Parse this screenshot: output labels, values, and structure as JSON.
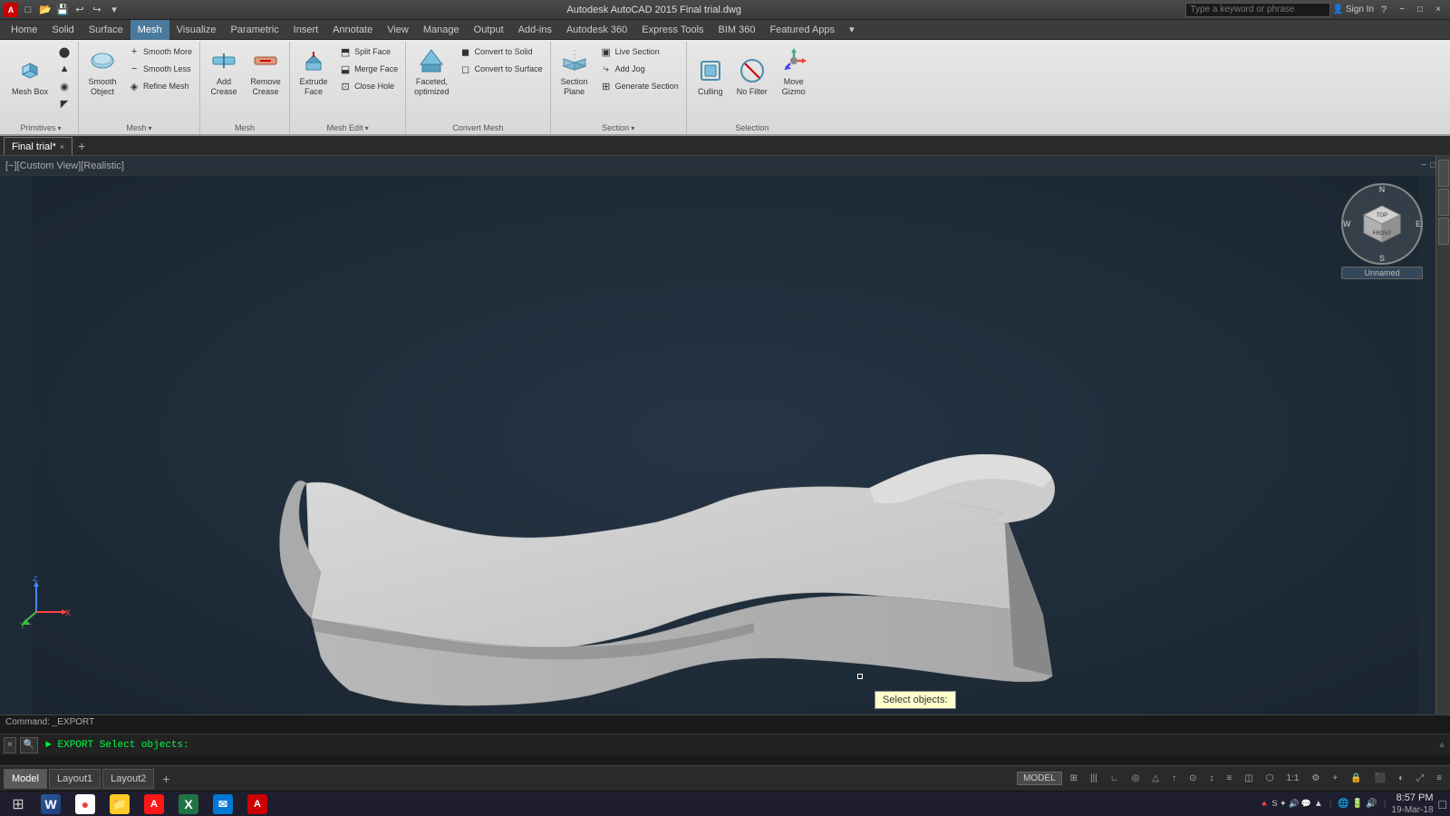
{
  "titlebar": {
    "title": "Autodesk AutoCAD 2015  Final trial.dwg",
    "search_placeholder": "Type a keyword or phrase",
    "sign_in": "Sign In",
    "app_icon": "A",
    "minimize": "−",
    "maximize": "□",
    "close": "×",
    "restore_down": "❐"
  },
  "menubar": {
    "items": [
      "Home",
      "Solid",
      "Surface",
      "Mesh",
      "Visualize",
      "Parametric",
      "Insert",
      "Annotate",
      "View",
      "Manage",
      "Output",
      "Add-ins",
      "Autodesk 360",
      "Express Tools",
      "BIM 360",
      "Featured Apps"
    ]
  },
  "ribbon": {
    "active_tab": "Mesh",
    "groups": [
      {
        "label": "Primitives",
        "has_arrow": true,
        "buttons_large": [
          {
            "id": "mesh-box",
            "label": "Mesh Box",
            "icon": "⬛"
          }
        ],
        "buttons_small_col1": [
          {
            "id": "mesh-cylinder",
            "label": "",
            "icon": "⬤"
          },
          {
            "id": "mesh-cone",
            "label": "",
            "icon": "▲"
          }
        ],
        "buttons_small_col2": [
          {
            "id": "mesh-sphere",
            "label": "",
            "icon": "◉"
          },
          {
            "id": "mesh-wedge",
            "label": "",
            "icon": "◤"
          }
        ]
      },
      {
        "label": "Mesh",
        "has_arrow": true,
        "buttons_large": [
          {
            "id": "smooth-object",
            "label": "Smooth Object",
            "icon": "✦"
          }
        ],
        "buttons_small": [
          {
            "id": "smooth-more",
            "label": "Smooth More",
            "icon": "+"
          },
          {
            "id": "smooth-less",
            "label": "Smooth Less",
            "icon": "−"
          },
          {
            "id": "refine-mesh",
            "label": "Refine Mesh",
            "icon": "◈"
          }
        ]
      },
      {
        "label": "Mesh",
        "has_arrow": false,
        "buttons_large": [
          {
            "id": "add-crease",
            "label": "Add Crease",
            "icon": "⟊"
          },
          {
            "id": "remove-crease",
            "label": "Remove Crease",
            "icon": "⟋"
          }
        ]
      },
      {
        "label": "Mesh Edit",
        "has_arrow": true,
        "buttons_large": [
          {
            "id": "extrude-face",
            "label": "Extrude Face",
            "icon": "⬆"
          }
        ],
        "buttons_small": [
          {
            "id": "split-face",
            "label": "Split Face",
            "icon": "⬒"
          },
          {
            "id": "merge-face",
            "label": "Merge Face",
            "icon": "⬓"
          },
          {
            "id": "close-hole",
            "label": "Close Hole",
            "icon": "⬔"
          }
        ]
      },
      {
        "label": "Convert Mesh",
        "has_arrow": false,
        "buttons_large": [
          {
            "id": "faceted-optimized",
            "label": "Faceted, optimized",
            "icon": "⬡"
          }
        ],
        "buttons_small": [
          {
            "id": "convert-to-solid",
            "label": "Convert to Solid",
            "icon": "◼"
          },
          {
            "id": "convert-to-surface",
            "label": "Convert to Surface",
            "icon": "◻"
          }
        ]
      },
      {
        "label": "Section",
        "has_arrow": true,
        "buttons_large": [
          {
            "id": "section-plane",
            "label": "Section Plane",
            "icon": "⧉"
          }
        ],
        "buttons_small": [
          {
            "id": "live-section",
            "label": "Live Section",
            "icon": "⬛"
          },
          {
            "id": "add-jog",
            "label": "Add Jog",
            "icon": "⤷"
          },
          {
            "id": "generate-section",
            "label": "Generate Section",
            "icon": "⊞"
          }
        ]
      },
      {
        "label": "Selection",
        "has_arrow": false,
        "buttons_large": [
          {
            "id": "culling",
            "label": "Culling",
            "icon": "⊡"
          },
          {
            "id": "no-filter",
            "label": "No Filter",
            "icon": "⊘"
          },
          {
            "id": "move-gizmo",
            "label": "Move Gizmo",
            "icon": "⊕"
          }
        ]
      }
    ]
  },
  "viewport": {
    "label": "[−][Custom View][Realistic]",
    "view_close": "×",
    "view_max": "□",
    "view_restore": "−"
  },
  "viewcube": {
    "top": "TOP",
    "front": "FRONT",
    "north": "N",
    "south": "S",
    "east": "E",
    "west": "W",
    "unnamed": "Unnamed"
  },
  "tooltip": {
    "text": "Select objects:"
  },
  "command": {
    "label": "Command:  _EXPORT",
    "input_text": "► EXPORT Select objects:",
    "icon_x": "×",
    "icon_search": "🔍"
  },
  "status_bar": {
    "model_btn": "MODEL",
    "right_icons": [
      "⊞",
      "|||",
      "∷",
      "≡",
      "↕",
      "⊿",
      "↑",
      "⊙",
      "1:1",
      "⚙",
      "＋",
      "✱",
      "◫",
      "⬜",
      "⊡",
      "⬡"
    ]
  },
  "doc_tabs": {
    "tabs": [
      {
        "label": "Final trial*",
        "active": true
      },
      {
        "label": "+",
        "is_add": true
      }
    ]
  },
  "layout_tabs": {
    "tabs": [
      {
        "label": "Model",
        "active": true
      },
      {
        "label": "Layout1",
        "active": false
      },
      {
        "label": "Layout2",
        "active": false
      }
    ],
    "add": "+"
  },
  "taskbar": {
    "apps": [
      {
        "id": "windows",
        "icon": "⊞",
        "label": "Windows"
      },
      {
        "id": "word",
        "icon": "W",
        "label": "Word",
        "color": "app-word"
      },
      {
        "id": "chrome",
        "icon": "●",
        "label": "Chrome",
        "color": "app-chrome"
      },
      {
        "id": "files",
        "icon": "📁",
        "label": "Files",
        "color": "app-files"
      },
      {
        "id": "acrobat",
        "icon": "A",
        "label": "Acrobat",
        "color": "app-acrobat"
      },
      {
        "id": "excel",
        "icon": "X",
        "label": "Excel",
        "color": "app-excel"
      },
      {
        "id": "mail",
        "icon": "✉",
        "label": "Mail",
        "color": "app-mail"
      },
      {
        "id": "autocad",
        "icon": "A",
        "label": "AutoCAD",
        "color": "app-autocad"
      }
    ],
    "clock": {
      "time": "8:57 PM",
      "date": "19-Mar-18"
    },
    "sys_icons": [
      "🔊",
      "💬",
      "🌐",
      "✦",
      "🔋",
      "🔺"
    ]
  }
}
